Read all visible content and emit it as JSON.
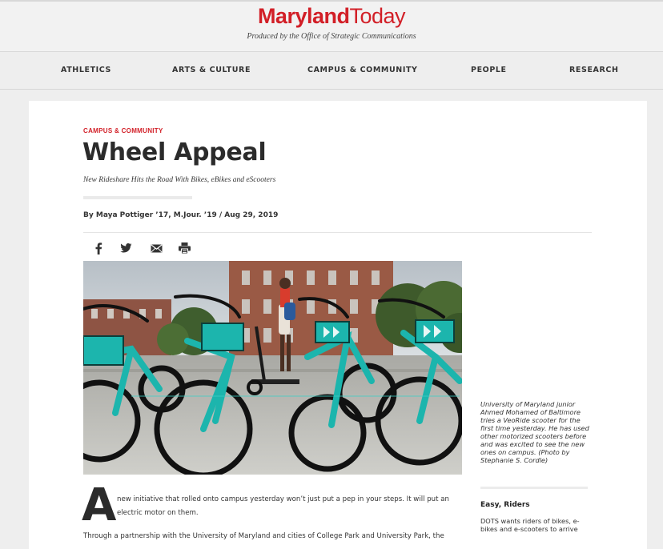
{
  "header": {
    "logo_part1": "Maryland",
    "logo_part2": "Today",
    "tagline": "Produced by the Office of Strategic Communications"
  },
  "nav": {
    "items": [
      "ATHLETICS",
      "ARTS & CULTURE",
      "CAMPUS & COMMUNITY",
      "PEOPLE",
      "RESEARCH"
    ]
  },
  "article": {
    "category": "CAMPUS & COMMUNITY",
    "title": "Wheel Appeal",
    "subtitle": "New Rideshare Hits the Road With Bikes, eBikes and eScooters",
    "byline": "By Maya Pottiger ’17, M.Jour. ’19  /  Aug 29, 2019",
    "dropcap": "A",
    "lead": "new initiative that rolled onto campus yesterday won’t just put a pep in your steps. It will put an electric motor on them.",
    "paragraph2": "Through a partnership with the University of Maryland and cities of College Park and University Park, the"
  },
  "share": {
    "icons": [
      "facebook-icon",
      "twitter-icon",
      "email-icon",
      "print-icon"
    ]
  },
  "photo": {
    "caption": "University of Maryland junior Ahmed Mohamed of Baltimore tries a VeoRide scooter for the first time yesterday. He has used other motorized scooters before and was excited to see the new ones on campus. (Photo by Stephanie S. Cordle)"
  },
  "sidebar": {
    "heading": "Easy, Riders",
    "text": "DOTS wants riders of bikes, e-bikes and e-scooters to arrive"
  },
  "colors": {
    "brand_red": "#d21f27",
    "bike_teal": "#1cb5ad"
  }
}
